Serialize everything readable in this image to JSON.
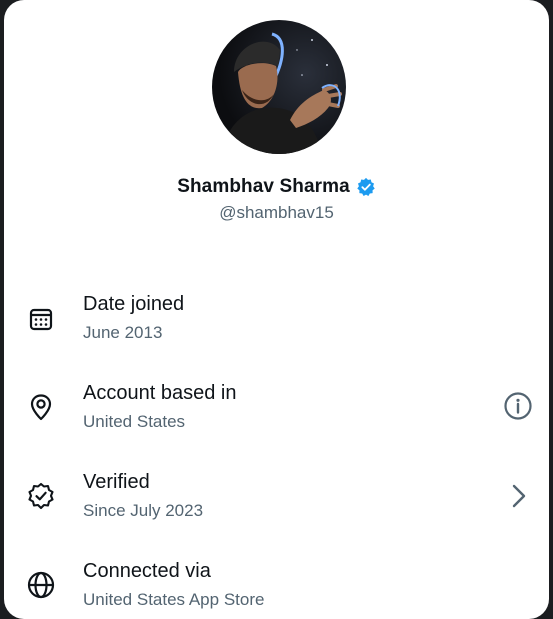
{
  "profile": {
    "display_name": "Shambhav Sharma",
    "handle": "@shambhav15",
    "verified_badge_color": "#1d9bf0"
  },
  "details": [
    {
      "icon": "calendar-icon",
      "title": "Date joined",
      "subtitle": "June 2013",
      "action": null
    },
    {
      "icon": "location-pin-icon",
      "title": "Account based in",
      "subtitle": "United States",
      "action": "info-icon"
    },
    {
      "icon": "verified-seal-icon",
      "title": "Verified",
      "subtitle": "Since July 2023",
      "action": "chevron-right-icon"
    },
    {
      "icon": "globe-icon",
      "title": "Connected via",
      "subtitle": "United States App Store",
      "action": null
    }
  ],
  "colors": {
    "text_primary": "#0f1419",
    "text_secondary": "#536471",
    "accent": "#1d9bf0"
  }
}
